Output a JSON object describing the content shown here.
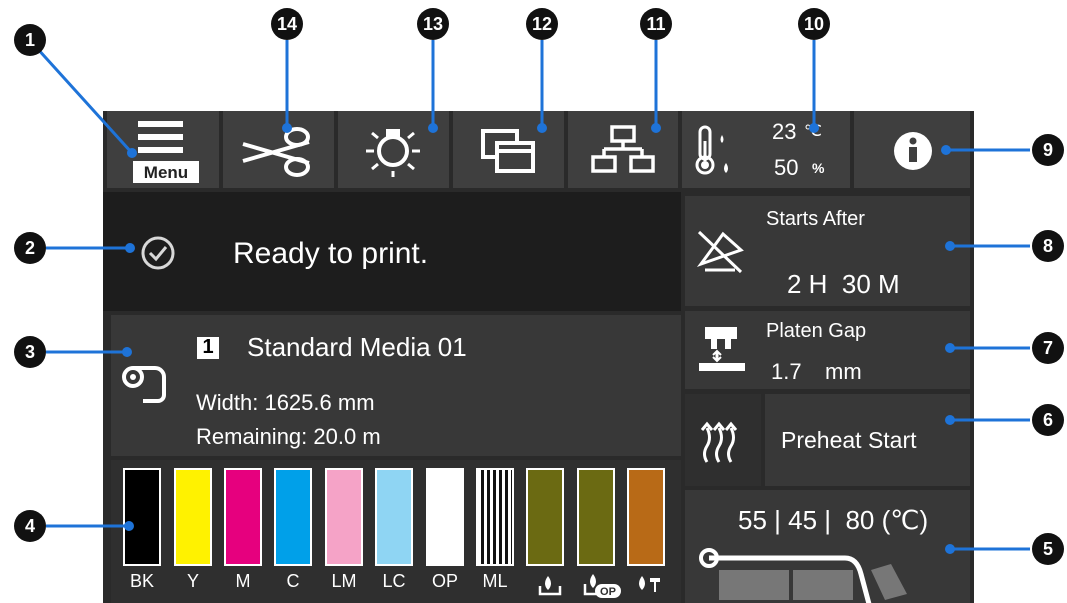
{
  "toolbar": {
    "menu_label": "Menu",
    "temperature_value": "23",
    "temperature_unit": "℃",
    "humidity_value": "50",
    "humidity_unit": "%"
  },
  "status": {
    "message": "Ready to print."
  },
  "media": {
    "number": "1",
    "name": "Standard Media 01",
    "width": "Width: 1625.6 mm",
    "remaining": "Remaining: 20.0 m"
  },
  "timer": {
    "label": "Starts After",
    "value": "2 H  30 M"
  },
  "platen": {
    "label": "Platen Gap",
    "value": "1.7",
    "unit": "mm"
  },
  "preheat": {
    "label": "Preheat Start"
  },
  "heater": {
    "values": "55 | 45 |  80 (℃)"
  },
  "inks": [
    {
      "label": "BK",
      "color": "#000000"
    },
    {
      "label": "Y",
      "color": "#fff200"
    },
    {
      "label": "M",
      "color": "#e6007e"
    },
    {
      "label": "C",
      "color": "#00a0e9"
    },
    {
      "label": "LM",
      "color": "#f5a3c7"
    },
    {
      "label": "LC",
      "color": "#8fd5f3"
    },
    {
      "label": "OP",
      "color": "#ffffff"
    },
    {
      "label": "ML",
      "color": "#ffffff"
    },
    {
      "label": "",
      "color": "#6b6a12"
    },
    {
      "label": "",
      "color": "#6b6a12"
    },
    {
      "label": "",
      "color": "#b86a17"
    }
  ],
  "callouts": [
    "1",
    "2",
    "3",
    "4",
    "5",
    "6",
    "7",
    "8",
    "9",
    "10",
    "11",
    "12",
    "13",
    "14"
  ],
  "colors": {
    "screen": "#2a2a2a",
    "button": "#3f3f3f",
    "panel": "#383838",
    "callout_line": "#1e73d8"
  }
}
